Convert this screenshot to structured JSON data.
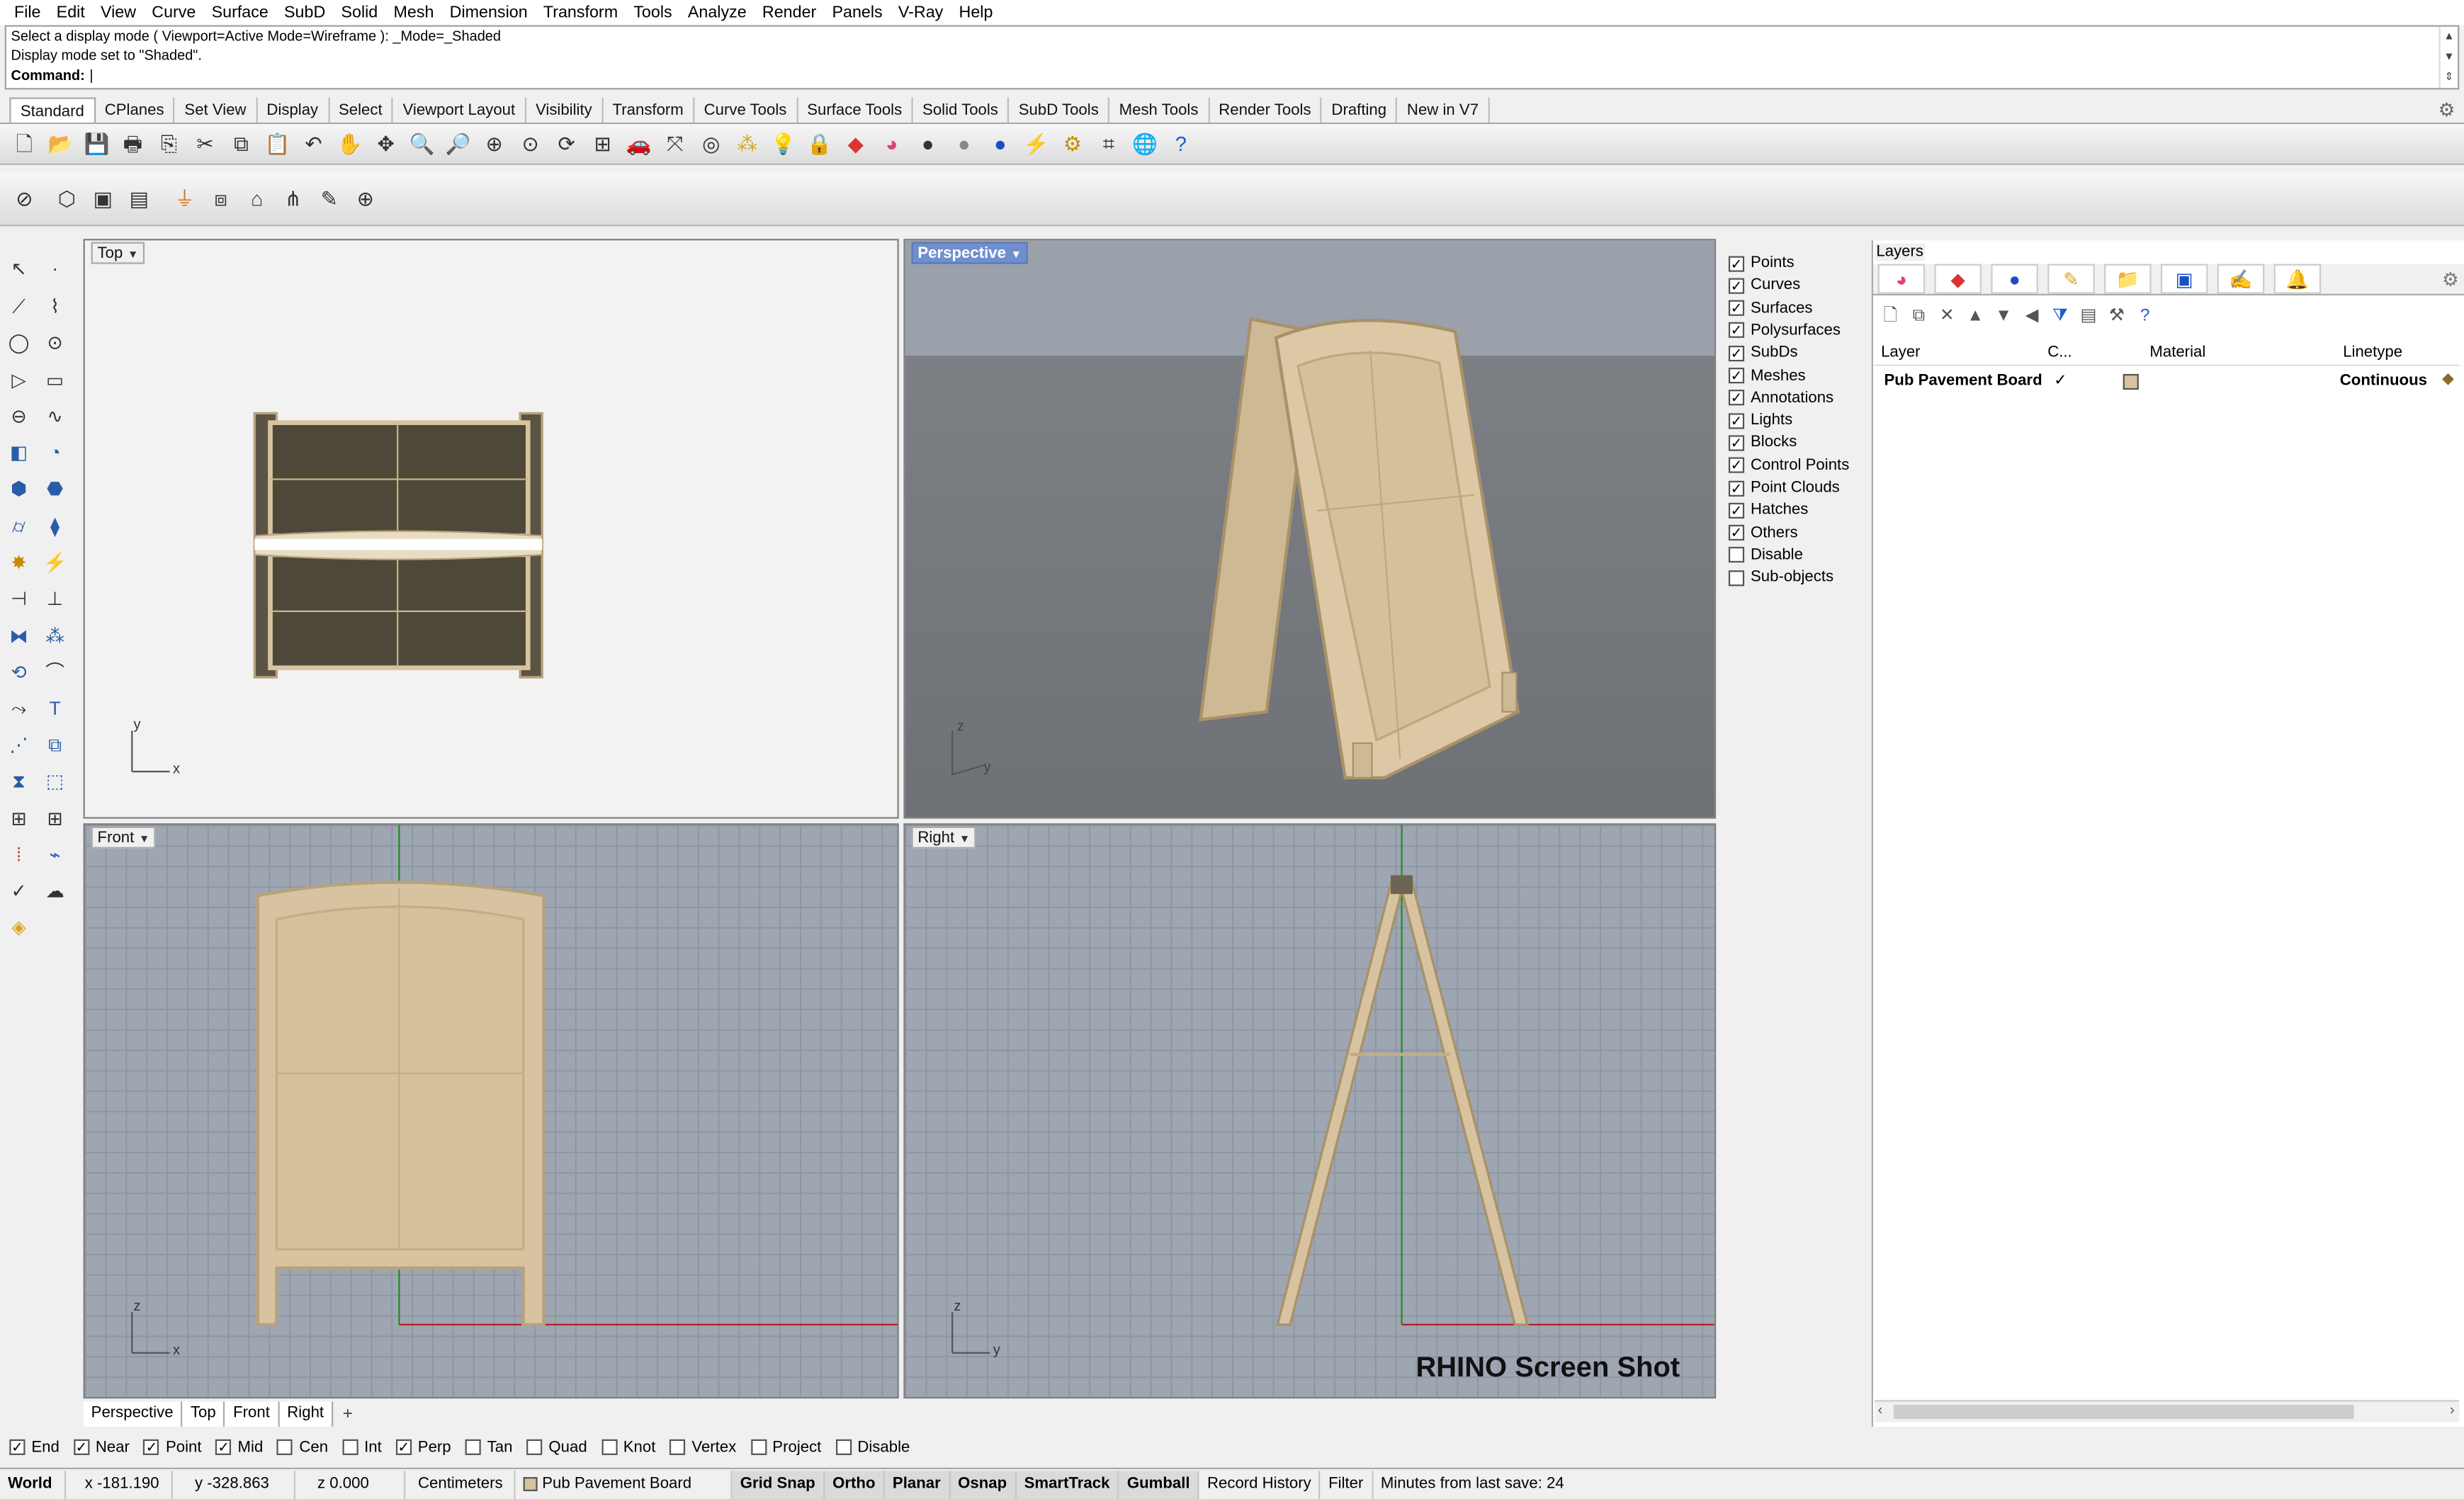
{
  "menu": [
    "File",
    "Edit",
    "View",
    "Curve",
    "Surface",
    "SubD",
    "Solid",
    "Mesh",
    "Dimension",
    "Transform",
    "Tools",
    "Analyze",
    "Render",
    "Panels",
    "V-Ray",
    "Help"
  ],
  "command": {
    "history_1": "Select a display mode ( Viewport=Active  Mode=Wireframe ): _Mode=_Shaded",
    "history_2": "Display mode set to \"Shaded\".",
    "prompt": "Command:"
  },
  "toolbar_tabs": [
    "Standard",
    "CPlanes",
    "Set View",
    "Display",
    "Select",
    "Viewport Layout",
    "Visibility",
    "Transform",
    "Curve Tools",
    "Surface Tools",
    "Solid Tools",
    "SubD Tools",
    "Mesh Tools",
    "Render Tools",
    "Drafting",
    "New in V7"
  ],
  "viewports": {
    "top": {
      "title": "Top",
      "axis_x": "x",
      "axis_y": "y"
    },
    "perspective": {
      "title": "Perspective",
      "axis_x": "y",
      "axis_z": "z"
    },
    "front": {
      "title": "Front",
      "axis_x": "x",
      "axis_z": "z"
    },
    "right": {
      "title": "Right",
      "axis_x": "y",
      "axis_z": "z"
    }
  },
  "watermark": "RHINO Screen Shot",
  "viewport_tabs": [
    "Perspective",
    "Top",
    "Front",
    "Right"
  ],
  "viewport_tabs_add": "+",
  "display_filter": [
    {
      "label": "Points",
      "checked": true
    },
    {
      "label": "Curves",
      "checked": true
    },
    {
      "label": "Surfaces",
      "checked": true
    },
    {
      "label": "Polysurfaces",
      "checked": true
    },
    {
      "label": "SubDs",
      "checked": true
    },
    {
      "label": "Meshes",
      "checked": true
    },
    {
      "label": "Annotations",
      "checked": true
    },
    {
      "label": "Lights",
      "checked": true
    },
    {
      "label": "Blocks",
      "checked": true
    },
    {
      "label": "Control Points",
      "checked": true
    },
    {
      "label": "Point Clouds",
      "checked": true
    },
    {
      "label": "Hatches",
      "checked": true
    },
    {
      "label": "Others",
      "checked": true
    },
    {
      "label": "Disable",
      "checked": false
    },
    {
      "label": "Sub-objects",
      "checked": false
    }
  ],
  "layers": {
    "title": "Layers",
    "columns": {
      "layer": "Layer",
      "current": "C...",
      "material": "Material",
      "linetype": "Linetype"
    },
    "rows": [
      {
        "name": "Pub Pavement Board",
        "current": "✓",
        "color": "#d8c3a0",
        "linetype": "Continuous"
      }
    ]
  },
  "osnaps": [
    {
      "label": "End",
      "checked": true
    },
    {
      "label": "Near",
      "checked": true
    },
    {
      "label": "Point",
      "checked": true
    },
    {
      "label": "Mid",
      "checked": true
    },
    {
      "label": "Cen",
      "checked": false
    },
    {
      "label": "Int",
      "checked": false
    },
    {
      "label": "Perp",
      "checked": true
    },
    {
      "label": "Tan",
      "checked": false
    },
    {
      "label": "Quad",
      "checked": false
    },
    {
      "label": "Knot",
      "checked": false
    },
    {
      "label": "Vertex",
      "checked": false
    },
    {
      "label": "Project",
      "checked": false
    },
    {
      "label": "Disable",
      "checked": false
    }
  ],
  "status": {
    "cplane": "World",
    "x": "x -181.190",
    "y": "y -328.863",
    "z": "z 0.000",
    "units": "Centimeters",
    "layer": "Pub Pavement Board",
    "grid_snap": "Grid Snap",
    "ortho": "Ortho",
    "planar": "Planar",
    "osnap": "Osnap",
    "smarttrack": "SmartTrack",
    "gumball": "Gumball",
    "record_history": "Record History",
    "filter": "Filter",
    "last_save": "Minutes from last save: 24"
  },
  "colors": {
    "board_fill": "#d8c3a0",
    "board_edge": "#a8916a",
    "perspective_highlight": "#6f8fcf",
    "x_axis": "#b22222",
    "y_axis": "#228b22"
  }
}
